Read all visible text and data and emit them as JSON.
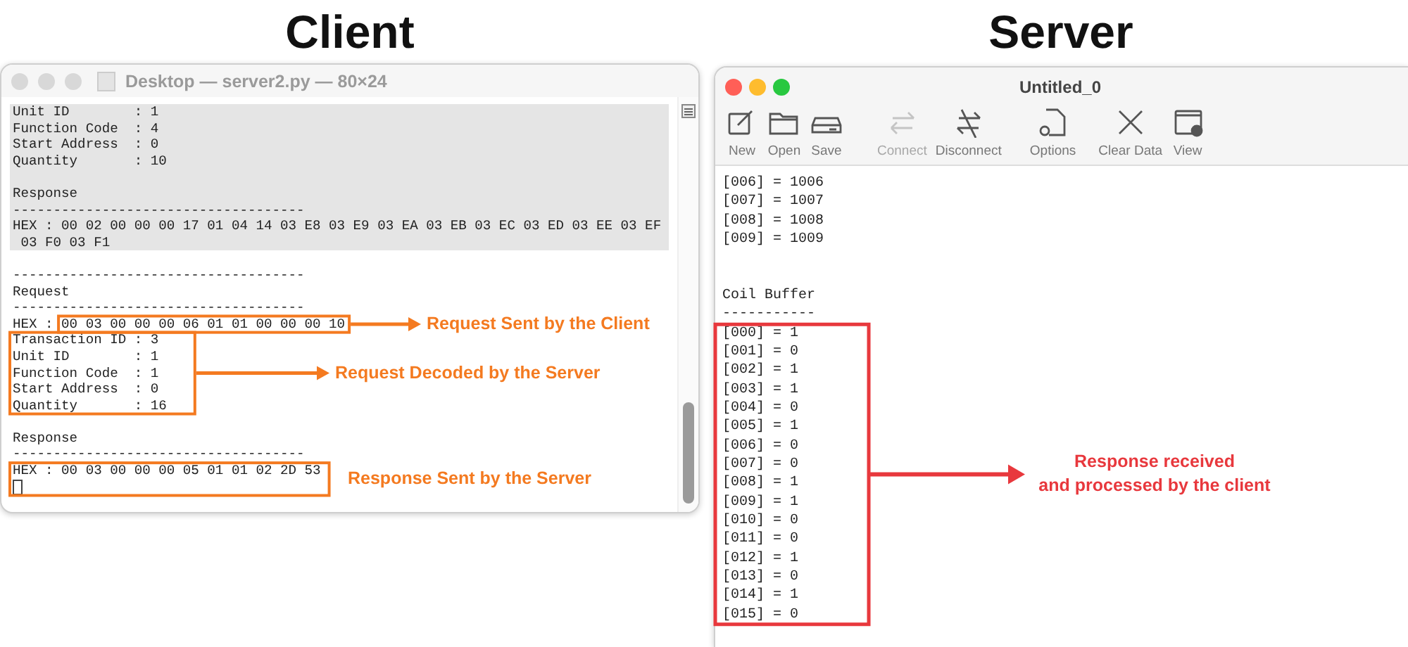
{
  "client_heading": "Client",
  "server_heading": "Server",
  "client_window": {
    "title": "Desktop — server2.py — 80×24",
    "cursor": true,
    "lines": [
      {
        "text": "Unit ID        : 1",
        "highlighted": true
      },
      {
        "text": "Function Code  : 4",
        "highlighted": true
      },
      {
        "text": "Start Address  : 0",
        "highlighted": true
      },
      {
        "text": "Quantity       : 10",
        "highlighted": true
      },
      {
        "highlighted": true
      },
      {
        "text": "Response",
        "highlighted": true
      },
      {
        "text": "------------------------------------",
        "highlighted": true
      },
      {
        "text": "HEX : 00 02 00 00 00 17 01 04 14 03 E8 03 E9 03 EA 03 EB 03 EC 03 ED 03 EE 03 EF",
        "highlighted": true
      },
      {
        "text": " 03 F0 03 F1",
        "highlighted": true
      },
      {
        "highlighted": false
      },
      {
        "text": "------------------------------------",
        "highlighted": false
      },
      {
        "text": "Request",
        "highlighted": false
      },
      {
        "text": "------------------------------------",
        "highlighted": false
      },
      {
        "text": "HEX : 00 03 00 00 00 06 01 01 00 00 00 10",
        "highlighted": false
      },
      {
        "text": "Transaction ID : 3",
        "highlighted": false
      },
      {
        "text": "Unit ID        : 1",
        "highlighted": false
      },
      {
        "text": "Function Code  : 1",
        "highlighted": false
      },
      {
        "text": "Start Address  : 0",
        "highlighted": false
      },
      {
        "text": "Quantity       : 16",
        "highlighted": false
      },
      {
        "highlighted": false
      },
      {
        "text": "Response",
        "highlighted": false
      },
      {
        "text": "------------------------------------",
        "highlighted": false
      },
      {
        "text": "HEX : 00 03 00 00 00 05 01 01 02 2D 53",
        "highlighted": false
      }
    ]
  },
  "server_window": {
    "title": "Untitled_0",
    "toolbar": [
      {
        "kind": "new",
        "label": "New",
        "disabled": false
      },
      {
        "kind": "open",
        "label": "Open",
        "disabled": false
      },
      {
        "kind": "save",
        "label": "Save",
        "disabled": false
      },
      {
        "kind": "connect",
        "label": "Connect",
        "disabled": true
      },
      {
        "kind": "disconnect",
        "label": "Disconnect",
        "disabled": false
      },
      {
        "kind": "options",
        "label": "Options",
        "disabled": false
      },
      {
        "kind": "clear",
        "label": "Clear Data",
        "disabled": false
      },
      {
        "kind": "view",
        "label": "View",
        "disabled": false
      }
    ],
    "lines": [
      {
        "kind": "text",
        "text": "[006] = 1006"
      },
      {
        "kind": "text",
        "text": "[007] = 1007"
      },
      {
        "kind": "text",
        "text": "[008] = 1008"
      },
      {
        "kind": "text",
        "text": "[009] = 1009"
      },
      {
        "kind": "blank"
      },
      {
        "kind": "blank"
      },
      {
        "kind": "text",
        "text": "Coil Buffer"
      },
      {
        "kind": "text",
        "text": "-----------"
      },
      {
        "kind": "text",
        "text": "[000] = 1"
      },
      {
        "kind": "text",
        "text": "[001] = 0"
      },
      {
        "kind": "text",
        "text": "[002] = 1"
      },
      {
        "kind": "text",
        "text": "[003] = 1"
      },
      {
        "kind": "text",
        "text": "[004] = 0"
      },
      {
        "kind": "text",
        "text": "[005] = 1"
      },
      {
        "kind": "text",
        "text": "[006] = 0"
      },
      {
        "kind": "text",
        "text": "[007] = 0"
      },
      {
        "kind": "text",
        "text": "[008] = 1"
      },
      {
        "kind": "text",
        "text": "[009] = 1"
      },
      {
        "kind": "text",
        "text": "[010] = 0"
      },
      {
        "kind": "text",
        "text": "[011] = 0"
      },
      {
        "kind": "text",
        "text": "[012] = 1"
      },
      {
        "kind": "text",
        "text": "[013] = 0"
      },
      {
        "kind": "text",
        "text": "[014] = 1"
      },
      {
        "kind": "text",
        "text": "[015] = 0"
      }
    ]
  },
  "annotations": [
    {
      "text": "Request Sent by the Client",
      "color": "#f47a20"
    },
    {
      "text": "Request Decoded by the Server",
      "color": "#f47a20"
    },
    {
      "text": "Response Sent by the Server",
      "color": "#f47a20"
    },
    {
      "text": "Response received\nand processed by the client",
      "color": "#e8383d"
    }
  ]
}
